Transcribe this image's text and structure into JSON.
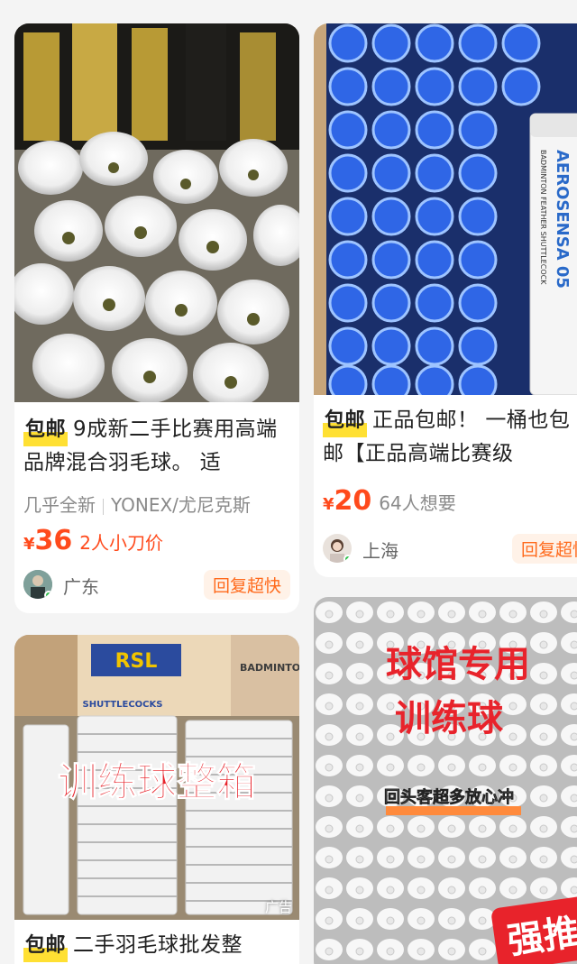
{
  "items": [
    {
      "badge": "包邮",
      "title": "9成新二手比赛用高端品牌混合羽毛球。 适",
      "tags": [
        "几乎全新",
        "YONEX/尤尼克斯"
      ],
      "currency": "¥",
      "price": "36",
      "price_note": "2人小刀价",
      "location": "广东",
      "reply_tag": "回复超快"
    },
    {
      "badge": "包邮",
      "title": "正品包邮！ 一桶也包邮【正品高端比赛级",
      "currency": "¥",
      "price": "20",
      "price_note": "64人想要",
      "location": "上海",
      "reply_tag": "回复超快",
      "image_text": "AEROSENSA 05",
      "image_subtext": "BADMINTON FEATHER SHUTTLECOCK"
    },
    {
      "image_text": "训练球整箱",
      "box_label": "RSL",
      "box_sub": "SHUTTLECOCKS",
      "box_right": "BADMINTON",
      "ad_label": "广告",
      "badge": "包邮",
      "title": "二手羽毛球批发整"
    },
    {
      "image_text_1": "球馆专用",
      "image_text_2": "训练球",
      "image_banner": "回头客超多放心冲",
      "image_corner": "强推"
    }
  ],
  "colors": {
    "price": "#ff4a1c",
    "badge_highlight": "#ffe033",
    "reply_tag_bg": "#fff2e8",
    "reply_tag_fg": "#ff6a1c"
  }
}
